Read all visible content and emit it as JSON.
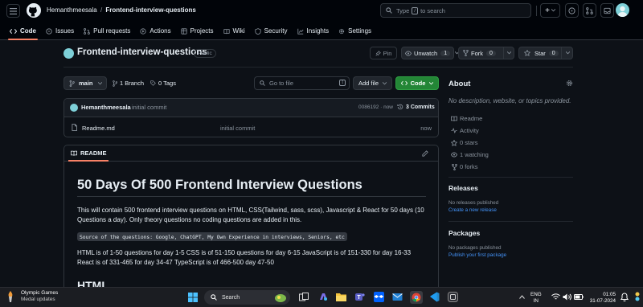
{
  "header": {
    "owner": "Hemanthmeesala",
    "slash": "/",
    "repo": "Frontend-interview-questions",
    "search_placeholder": "Type / to search",
    "search_pre": "Type",
    "search_key": "/",
    "search_post": "to search",
    "plus": "+"
  },
  "tabs": [
    {
      "label": "Code"
    },
    {
      "label": "Issues"
    },
    {
      "label": "Pull requests"
    },
    {
      "label": "Actions"
    },
    {
      "label": "Projects"
    },
    {
      "label": "Wiki"
    },
    {
      "label": "Security"
    },
    {
      "label": "Insights"
    },
    {
      "label": "Settings"
    }
  ],
  "repo_header": {
    "name": "Frontend-interview-questions",
    "visibility": "Public",
    "pin": "Pin",
    "unwatch": "Unwatch",
    "unwatch_count": "1",
    "fork": "Fork",
    "fork_count": "0",
    "star": "Star",
    "star_count": "0"
  },
  "toolbar": {
    "branch": "main",
    "branches": "1 Branch",
    "tags": "0 Tags",
    "goto_placeholder": "Go to file",
    "goto_key": "t",
    "add_file": "Add file",
    "code": "Code"
  },
  "commit": {
    "author": "Hemanthmeesala",
    "message": "initial commit",
    "hash_time": "0086192 · now",
    "commits": "3 Commits"
  },
  "files": [
    {
      "name": "Readme.md",
      "message": "initial commit",
      "time": "now"
    }
  ],
  "readme": {
    "tab": "README",
    "title": "50 Days Of 500 Frontend Interview Questions",
    "p1": "This will contain 500 frontend interview questions on HTML, CSS(Tailwind, sass, scss), Javascript & React for 50 days (10 Questions a day). Only theory questions no coding questions are added in this.",
    "code": "Source of the questions: Google, ChatGPT, My Own Experience in interviews, Seniors, etc",
    "p2": "HTML is of 1-50 questions for day 1-5 CSS is of 51-150 questions for day 6-15 JavaScript is of 151-330 for day 16-33 React is of 331-465 for day 34-47 TypeScript is of 466-500 day 47-50",
    "h2": "HTML"
  },
  "about": {
    "title": "About",
    "desc": "No description, website, or topics provided.",
    "items": [
      {
        "label": "Readme",
        "icon": "book-icon"
      },
      {
        "label": "Activity",
        "icon": "pulse-icon"
      },
      {
        "label": "0 stars",
        "icon": "star-icon"
      },
      {
        "label": "1 watching",
        "icon": "eye-icon"
      },
      {
        "label": "0 forks",
        "icon": "fork-icon"
      }
    ]
  },
  "releases": {
    "title": "Releases",
    "none": "No releases published",
    "create": "Create a new release"
  },
  "packages": {
    "title": "Packages",
    "none": "No packages published",
    "publish": "Publish your first package"
  },
  "taskbar": {
    "weather_title": "Olympic Games",
    "weather_sub": "Medal updates",
    "search": "Search",
    "lang1": "ENG",
    "lang2": "IN",
    "time": "01:05",
    "date": "31-07-2024"
  },
  "colors": {
    "bg": "#0d1117",
    "border": "#30363d",
    "accent": "#4493f8",
    "green": "#238636",
    "tab_underline": "#f78166"
  }
}
